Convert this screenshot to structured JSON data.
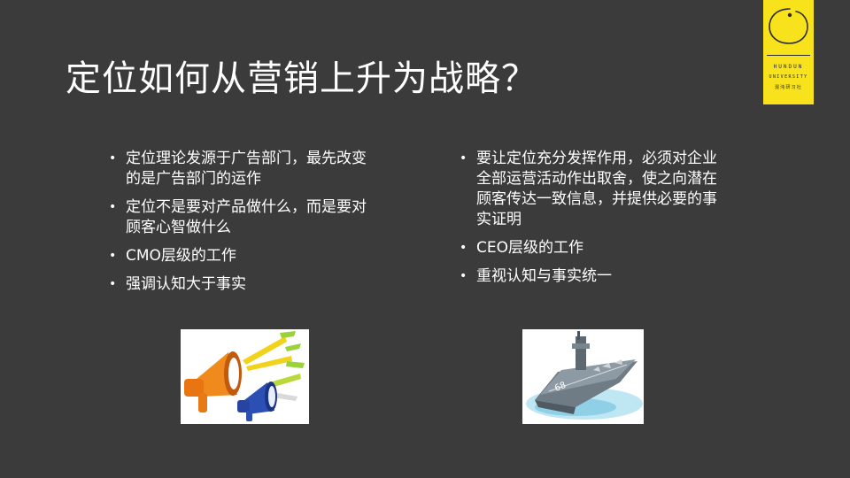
{
  "slide": {
    "title": "定位如何从营销上升为战略？"
  },
  "logo": {
    "line1": "HUNDUN",
    "line2": "UNIVERSITY",
    "line3": "混沌研习社",
    "color": "#f7e21b"
  },
  "left_column": {
    "items": [
      "定位理论发源于广告部门，最先改变的是广告部门的运作",
      "定位不是要对产品做什么，而是要对顾客心智做什么",
      "CMO层级的工作",
      "强调认知大于事实"
    ]
  },
  "right_column": {
    "items": [
      "要让定位充分发挥作用，必须对企业全部运营活动作出取舍，使之向潜在顾客传达一致信息，并提供必要的事实证明",
      "CEO层级的工作",
      "重视认知与事实统一"
    ]
  },
  "images": {
    "left": "megaphone-illustration",
    "right": "aircraft-carrier-illustration"
  },
  "colors": {
    "background": "#3b3b3b",
    "text": "#ffffff",
    "accent": "#f7e21b"
  }
}
